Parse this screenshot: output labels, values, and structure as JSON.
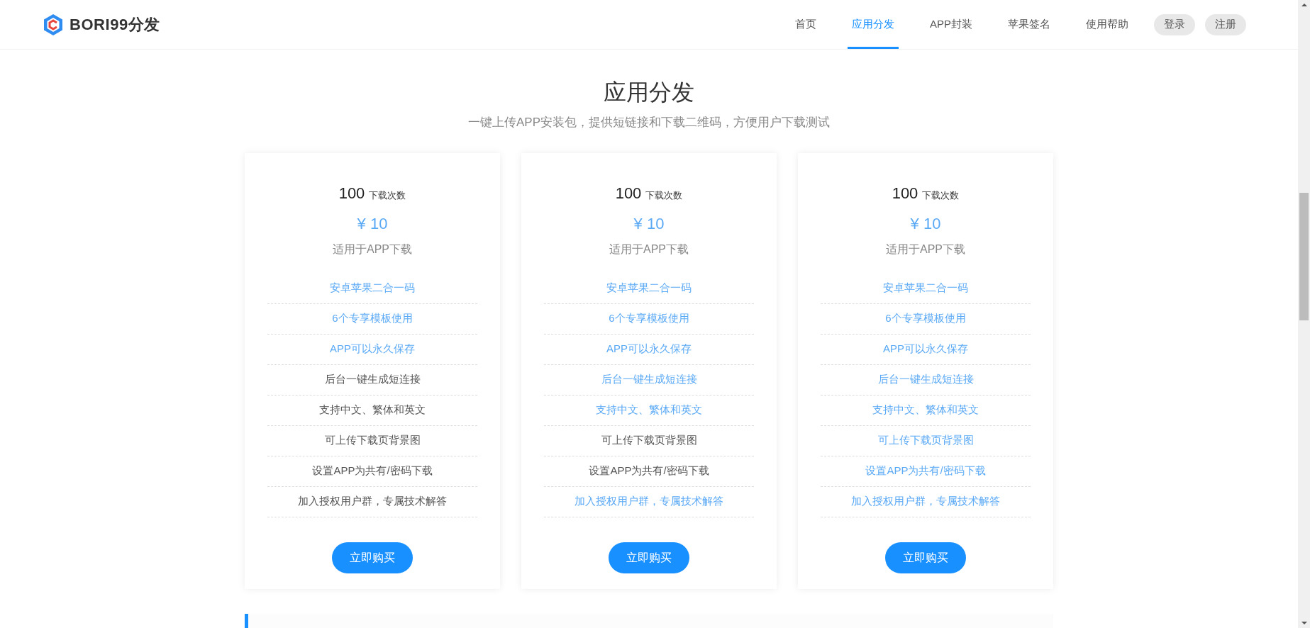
{
  "header": {
    "brand": "BORI99分发",
    "nav": [
      {
        "label": "首页",
        "selected": false
      },
      {
        "label": "应用分发",
        "selected": true
      },
      {
        "label": "APP封装",
        "selected": false
      },
      {
        "label": "苹果签名",
        "selected": false
      },
      {
        "label": "使用帮助",
        "selected": false
      }
    ],
    "account_buttons": [
      "登录",
      "注册"
    ]
  },
  "hero": {
    "title": "应用分发",
    "subtitle": "一键上传APP安装包，提供短链接和下载二维码，方便用户下载测试"
  },
  "plans": [
    {
      "count": "100",
      "count_unit": "下载次数",
      "price": "¥ 10",
      "note": "适用于APP下载",
      "button": "立即购买",
      "features": [
        {
          "label": "安卓苹果二合一码",
          "included": true
        },
        {
          "label": "6个专享模板使用",
          "included": true
        },
        {
          "label": "APP可以永久保存",
          "included": true
        },
        {
          "label": "后台一键生成短连接",
          "included": false
        },
        {
          "label": "支持中文、繁体和英文",
          "included": false
        },
        {
          "label": "可上传下载页背景图",
          "included": false
        },
        {
          "label": "设置APP为共有/密码下载",
          "included": false
        },
        {
          "label": "加入授权用户群，专属技术解答",
          "included": false
        }
      ]
    },
    {
      "count": "100",
      "count_unit": "下载次数",
      "price": "¥ 10",
      "note": "适用于APP下载",
      "button": "立即购买",
      "features": [
        {
          "label": "安卓苹果二合一码",
          "included": true
        },
        {
          "label": "6个专享模板使用",
          "included": true
        },
        {
          "label": "APP可以永久保存",
          "included": true
        },
        {
          "label": "后台一键生成短连接",
          "included": true
        },
        {
          "label": "支持中文、繁体和英文",
          "included": true
        },
        {
          "label": "可上传下载页背景图",
          "included": false
        },
        {
          "label": "设置APP为共有/密码下载",
          "included": false
        },
        {
          "label": "加入授权用户群，专属技术解答",
          "included": true
        }
      ]
    },
    {
      "count": "100",
      "count_unit": "下载次数",
      "price": "¥ 10",
      "note": "适用于APP下载",
      "button": "立即购买",
      "features": [
        {
          "label": "安卓苹果二合一码",
          "included": true
        },
        {
          "label": "6个专享模板使用",
          "included": true
        },
        {
          "label": "APP可以永久保存",
          "included": true
        },
        {
          "label": "后台一键生成短连接",
          "included": true
        },
        {
          "label": "支持中文、繁体和英文",
          "included": true
        },
        {
          "label": "可上传下载页背景图",
          "included": true
        },
        {
          "label": "设置APP为共有/密码下载",
          "included": true
        },
        {
          "label": "加入授权用户群，专属技术解答",
          "included": true
        }
      ]
    }
  ]
}
